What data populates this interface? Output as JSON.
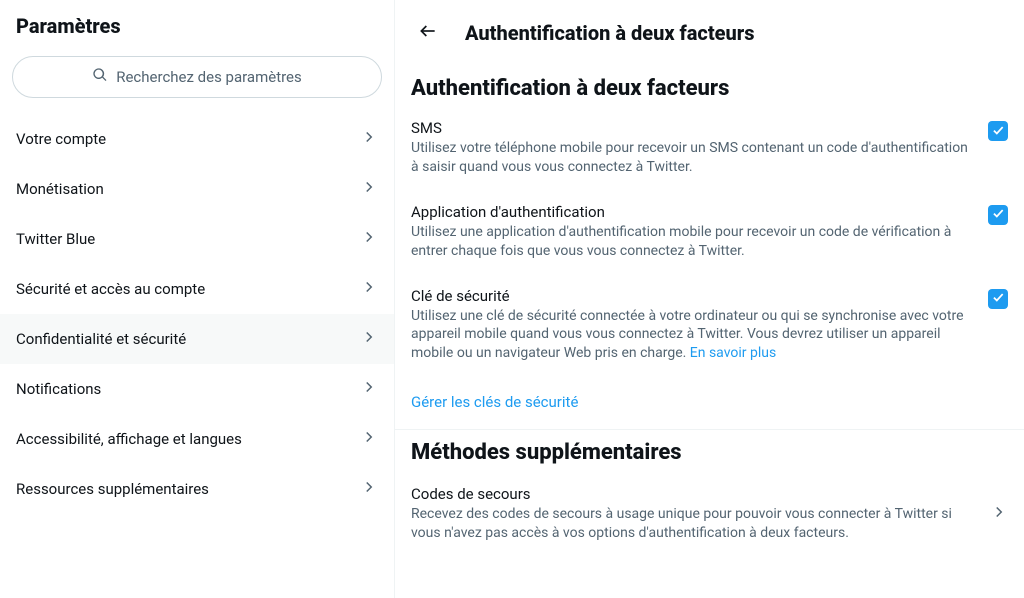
{
  "sidebar": {
    "title": "Paramètres",
    "search_placeholder": "Recherchez des paramètres",
    "items": [
      {
        "label": "Votre compte"
      },
      {
        "label": "Monétisation"
      },
      {
        "label": "Twitter Blue"
      },
      {
        "label": "Sécurité et accès au compte"
      },
      {
        "label": "Confidentialité et sécurité"
      },
      {
        "label": "Notifications"
      },
      {
        "label": "Accessibilité, affichage et langues"
      },
      {
        "label": "Ressources supplémentaires"
      }
    ],
    "active_index": 4
  },
  "main": {
    "header_title": "Authentification à deux facteurs",
    "section1_title": "Authentification à deux facteurs",
    "methods": [
      {
        "title": "SMS",
        "desc": "Utilisez votre téléphone mobile pour recevoir un SMS contenant un code d'authentification à saisir quand vous vous connectez à Twitter.",
        "checked": true
      },
      {
        "title": "Application d'authentification",
        "desc": "Utilisez une application d'authentification mobile pour recevoir un code de vérification à entrer chaque fois que vous vous connectez à Twitter.",
        "checked": true
      },
      {
        "title": "Clé de sécurité",
        "desc": "Utilisez une clé de sécurité connectée à votre ordinateur ou qui se synchronise avec votre appareil mobile quand vous vous connectez à Twitter. Vous devrez utiliser un appareil mobile ou un navigateur Web pris en charge. ",
        "learn_more": "En savoir plus",
        "checked": true
      }
    ],
    "manage_keys_link": "Gérer les clés de sécurité",
    "section2_title": "Méthodes supplémentaires",
    "backup": {
      "title": "Codes de secours",
      "desc": "Recevez des codes de secours à usage unique pour pouvoir vous connecter à Twitter si vous n'avez pas accès à vos options d'authentification à deux facteurs."
    }
  }
}
